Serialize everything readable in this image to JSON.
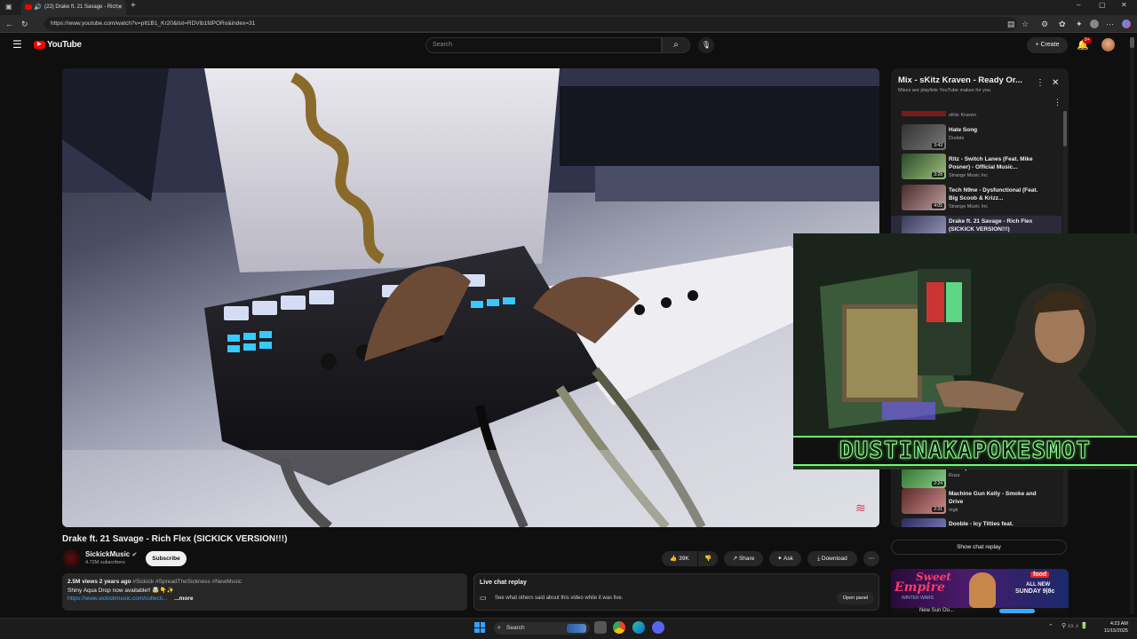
{
  "browser": {
    "tab_title": "(22) Drake ft. 21 Savage - Rich",
    "url": "https://www.youtube.com/watch?v=pIt1B1_Kr20&list=RDVib1fdPORo&index=31"
  },
  "header": {
    "logo": "YouTube",
    "search_placeholder": "Search",
    "create_label": "Create",
    "notif_badge": "9+"
  },
  "video": {
    "title": "Drake ft. 21 Savage - Rich Flex (SICKICK VERSION!!!)",
    "channel": "SickickMusic",
    "subscribers": "4.72M subscribers",
    "subscribe_label": "Subscribe",
    "likes": "39K",
    "share_label": "Share",
    "ask_label": "Ask",
    "download_label": "Download"
  },
  "description": {
    "meta": "2.5M views  2 years ago",
    "hashtags": "#Sickick #SpreadTheSickness #NewMusic",
    "line2": "Shiny Aqua Drop now available!! 🤯👇✨",
    "link": "https://www.sickickmusic.com/collecti...",
    "more": "...more"
  },
  "live_chat": {
    "title": "Live chat replay",
    "text": "See what others said about this video while it was live.",
    "open_label": "Open panel"
  },
  "playlist": {
    "title": "Mix - sKitz Kraven - Ready Or...",
    "subtitle": "Mixes are playlists YouTube makes for you",
    "top_channel": "sKitz Kraven",
    "items": [
      {
        "title": "Hate Song",
        "channel": "Dooble",
        "duration": "3:43"
      },
      {
        "title": "Ritz - Switch Lanes (Feat. Mike Posner) - Official Music...",
        "channel": "Strange Music Inc",
        "duration": "3:28"
      },
      {
        "title": "Tech N9ne - Dysfunctional (Feat. Big Scoob & Krizz...",
        "channel": "Strange Music Inc",
        "duration": "4:05"
      },
      {
        "title": "Drake ft. 21 Savage - Rich Flex (SICKICK VERSION!!!)",
        "channel": "",
        "duration": ""
      }
    ],
    "lower_items": [
      {
        "title": "Audio)",
        "channel": "Russ",
        "duration": "2:24"
      },
      {
        "title": "Machine Gun Kelly - Smoke and Drive",
        "channel": "mgk",
        "duration": "2:31"
      },
      {
        "title": "Dooble - Icy Titties feat.",
        "channel": "",
        "duration": ""
      }
    ],
    "show_chat": "Show chat replay"
  },
  "ad": {
    "line1": "Sweet",
    "line2": "Empire",
    "sub": "WINTER WARS",
    "brand": "food",
    "cta1": "ALL NEW",
    "cta2": "SUNDAY 9|8c",
    "below": "New Sun Oo..."
  },
  "webcam": {
    "name": "DUSTINAKAPOKESMOT"
  },
  "taskbar": {
    "search": "Search",
    "time": "4:23 AM",
    "date": "11/15/2025"
  },
  "colors": {
    "yt_red": "#ff0000",
    "bg": "#0f0f0f",
    "webcam_green": "#6aff6a"
  }
}
